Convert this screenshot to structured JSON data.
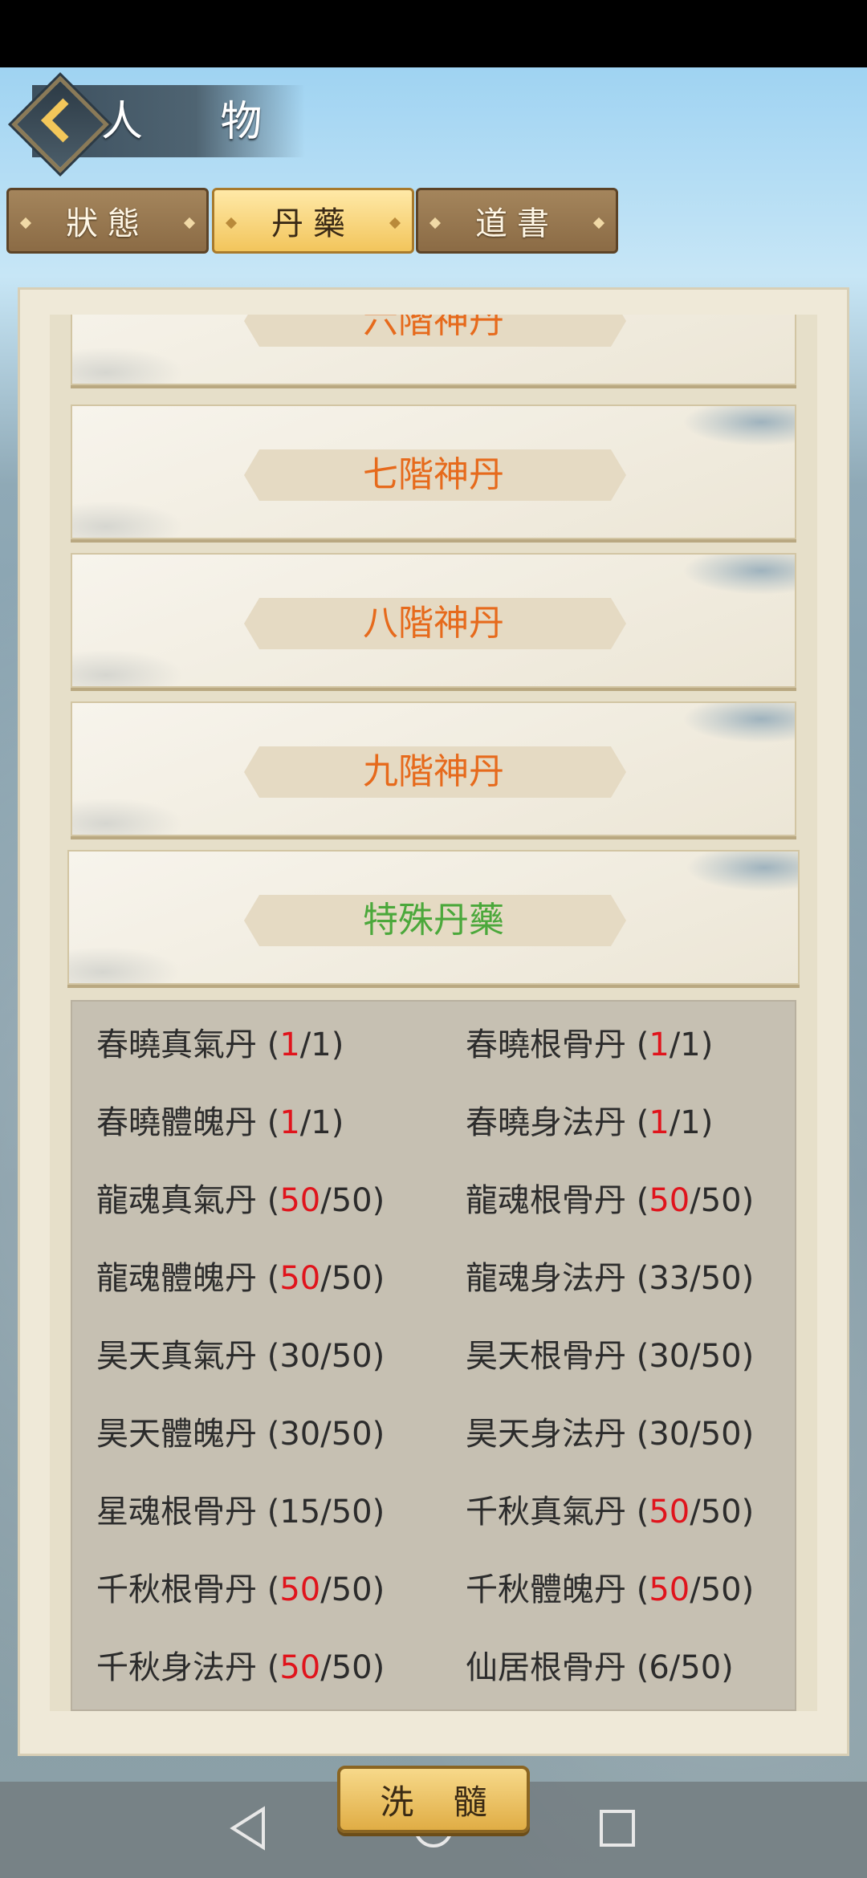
{
  "header": {
    "title": "人 物"
  },
  "tabs": [
    {
      "label": "狀態",
      "active": false
    },
    {
      "label": "丹藥",
      "active": true
    },
    {
      "label": "道書",
      "active": false
    }
  ],
  "categories": [
    {
      "label": "六階神丹",
      "partial": true
    },
    {
      "label": "七階神丹"
    },
    {
      "label": "八階神丹"
    },
    {
      "label": "九階神丹"
    },
    {
      "label": "特殊丹藥",
      "selected": true
    }
  ],
  "pills": [
    {
      "name": "春曉真氣丹",
      "current": "1",
      "max": "1",
      "full": true
    },
    {
      "name": "春曉根骨丹",
      "current": "1",
      "max": "1",
      "full": true
    },
    {
      "name": "春曉體魄丹",
      "current": "1",
      "max": "1",
      "full": true
    },
    {
      "name": "春曉身法丹",
      "current": "1",
      "max": "1",
      "full": true
    },
    {
      "name": "龍魂真氣丹",
      "current": "50",
      "max": "50",
      "full": true
    },
    {
      "name": "龍魂根骨丹",
      "current": "50",
      "max": "50",
      "full": true
    },
    {
      "name": "龍魂體魄丹",
      "current": "50",
      "max": "50",
      "full": true
    },
    {
      "name": "龍魂身法丹",
      "current": "33",
      "max": "50",
      "full": false
    },
    {
      "name": "昊天真氣丹",
      "current": "30",
      "max": "50",
      "full": false
    },
    {
      "name": "昊天根骨丹",
      "current": "30",
      "max": "50",
      "full": false
    },
    {
      "name": "昊天體魄丹",
      "current": "30",
      "max": "50",
      "full": false
    },
    {
      "name": "昊天身法丹",
      "current": "30",
      "max": "50",
      "full": false
    },
    {
      "name": "星魂根骨丹",
      "current": "15",
      "max": "50",
      "full": false
    },
    {
      "name": "千秋真氣丹",
      "current": "50",
      "max": "50",
      "full": true
    },
    {
      "name": "千秋根骨丹",
      "current": "50",
      "max": "50",
      "full": true
    },
    {
      "name": "千秋體魄丹",
      "current": "50",
      "max": "50",
      "full": true
    },
    {
      "name": "千秋身法丹",
      "current": "50",
      "max": "50",
      "full": true
    },
    {
      "name": "仙居根骨丹",
      "current": "6",
      "max": "50",
      "full": false
    }
  ],
  "actions": {
    "wash_label": "洗 髓"
  },
  "colors": {
    "category_text": "#e66a1c",
    "selected_category_text": "#4ba83b",
    "full_count": "#e0141c"
  }
}
